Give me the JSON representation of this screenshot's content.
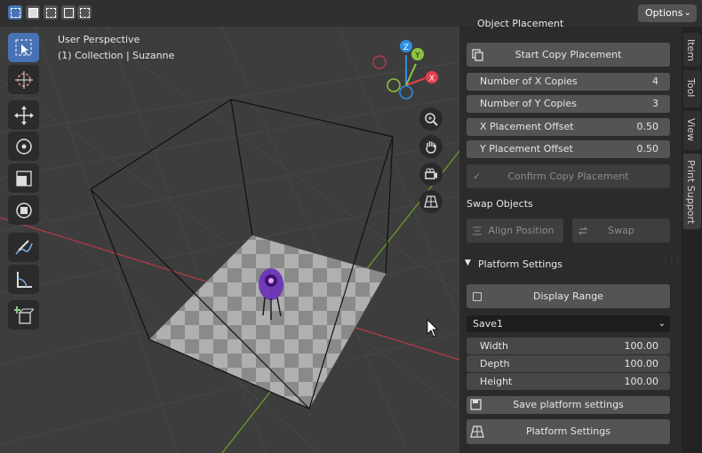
{
  "header": {
    "options_label": "Options"
  },
  "viewport": {
    "perspective_label": "User Perspective",
    "collection_label": "(1) Collection | Suzanne",
    "gizmo": {
      "x_label": "X",
      "y_label": "Y",
      "z_label": "Z",
      "x_color": "#e2404f",
      "y_color": "#8bc53e",
      "z_color": "#2e8de3"
    },
    "grid_axis_colors": {
      "x_axis": "#b03a48",
      "y_axis": "#6a9a2b"
    }
  },
  "toolbar": {
    "tools": [
      "select-box-icon",
      "cursor-icon",
      "move-icon",
      "rotate-icon",
      "scale-icon",
      "transform-icon",
      "annotate-icon",
      "measure-icon",
      "add-cube-icon"
    ]
  },
  "sidebar": {
    "object_placement_title": "Object Placement",
    "start_copy_label": "Start Copy Placement",
    "fields": [
      {
        "label": "Number of X Copies",
        "value": "4"
      },
      {
        "label": "Number of Y Copies",
        "value": "3"
      },
      {
        "label": "X Placement Offset",
        "value": "0.50"
      },
      {
        "label": "Y Placement Offset",
        "value": "0.50"
      }
    ],
    "confirm_label": "Confirm Copy Placement",
    "swap_objects_label": "Swap Objects",
    "align_position_label": "Align Position",
    "swap_label": "Swap",
    "platform_settings_title": "Platform Settings",
    "display_range_label": "Display Range",
    "preset_value": "Save1",
    "dimensions": [
      {
        "label": "Width",
        "value": "100.00"
      },
      {
        "label": "Depth",
        "value": "100.00"
      },
      {
        "label": "Height",
        "value": "100.00"
      }
    ],
    "save_platform_label": "Save platform settings",
    "platform_settings_button_label": "Platform Settings"
  },
  "tabs": {
    "item": "Item",
    "tool": "Tool",
    "view": "View",
    "print_support": "Print Support"
  },
  "accent_color": "#4772b3"
}
